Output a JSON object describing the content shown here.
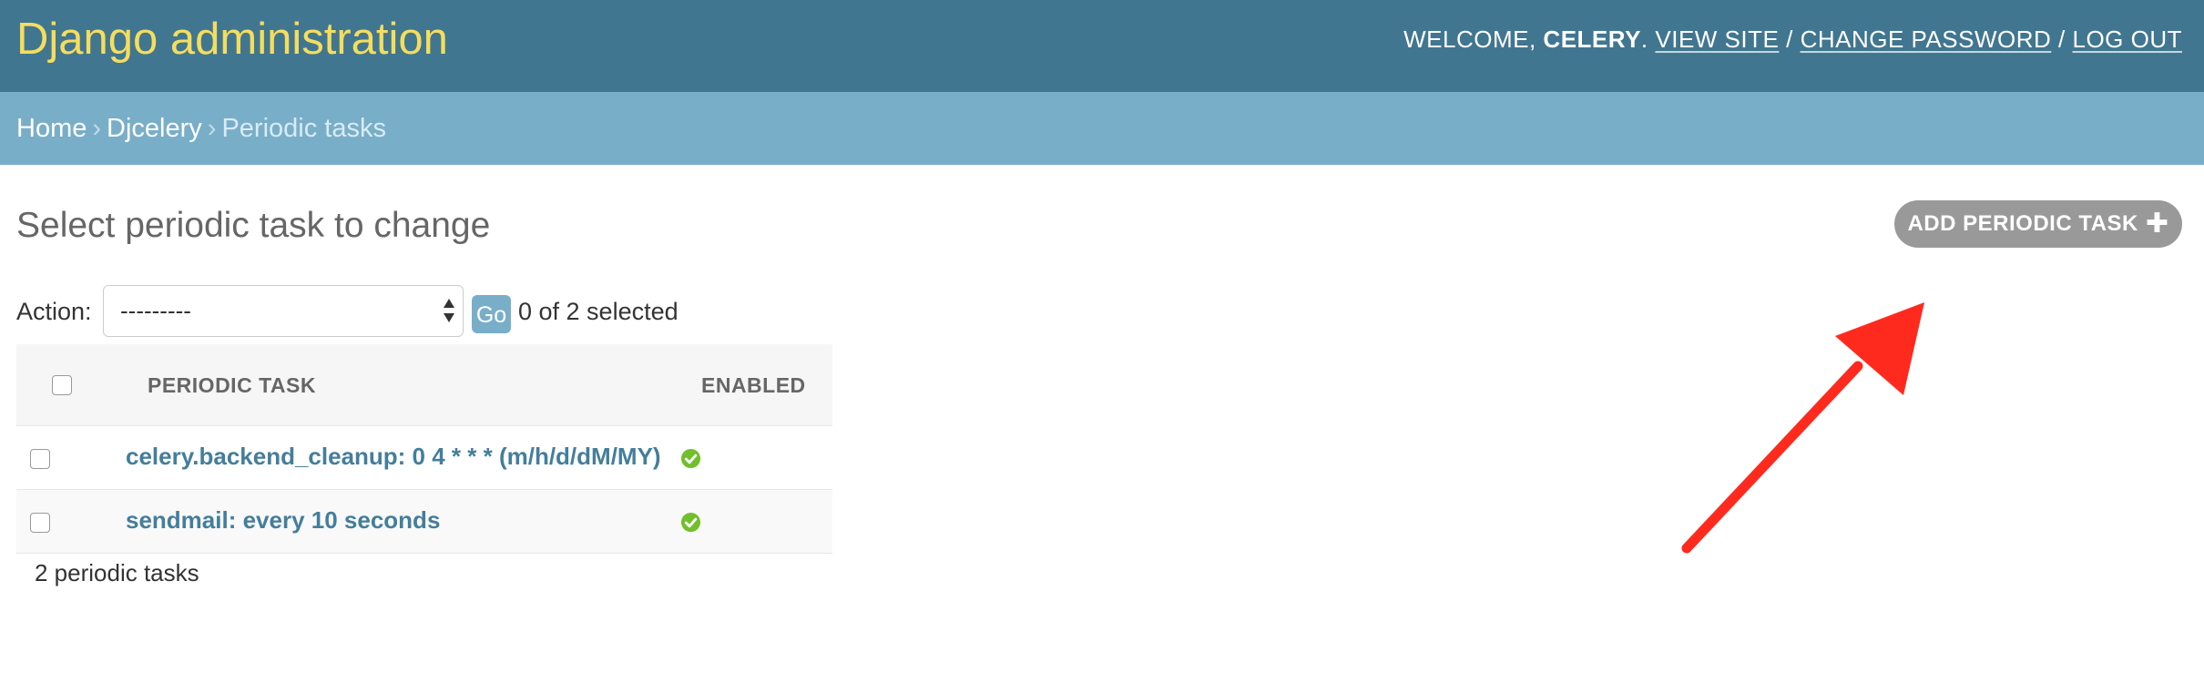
{
  "header": {
    "branding": "Django administration",
    "welcome_prefix": "WELCOME,",
    "username": "CELERY",
    "username_suffix": ".",
    "view_site": "VIEW SITE",
    "change_password": "CHANGE PASSWORD",
    "log_out": "LOG OUT",
    "separator": "/"
  },
  "breadcrumbs": {
    "home": "Home",
    "app": "Djcelery",
    "current": "Periodic tasks",
    "separator": "›"
  },
  "content": {
    "title": "Select periodic task to change",
    "add_button": "ADD PERIODIC TASK",
    "add_icon": "plus-icon"
  },
  "actions": {
    "label": "Action:",
    "selected_option": "---------",
    "go_label": "Go",
    "selection_counter": "0 of 2 selected"
  },
  "table": {
    "columns": [
      "PERIODIC TASK",
      "ENABLED"
    ],
    "rows": [
      {
        "task": "celery.backend_cleanup: 0 4 * * * (m/h/d/dM/MY)",
        "enabled": true,
        "enabled_icon": "check-circle-icon"
      },
      {
        "task": "sendmail: every 10 seconds",
        "enabled": true,
        "enabled_icon": "check-circle-icon"
      }
    ],
    "paginator": "2 periodic tasks"
  },
  "colors": {
    "header_bg": "#417690",
    "branding": "#f5dd5d",
    "breadcrumbs_bg": "#79aec8",
    "link": "#447e9b",
    "add_button_bg": "#999999",
    "enabled_icon": "#70bf2b",
    "annotation_arrow": "#ff2a1e"
  }
}
